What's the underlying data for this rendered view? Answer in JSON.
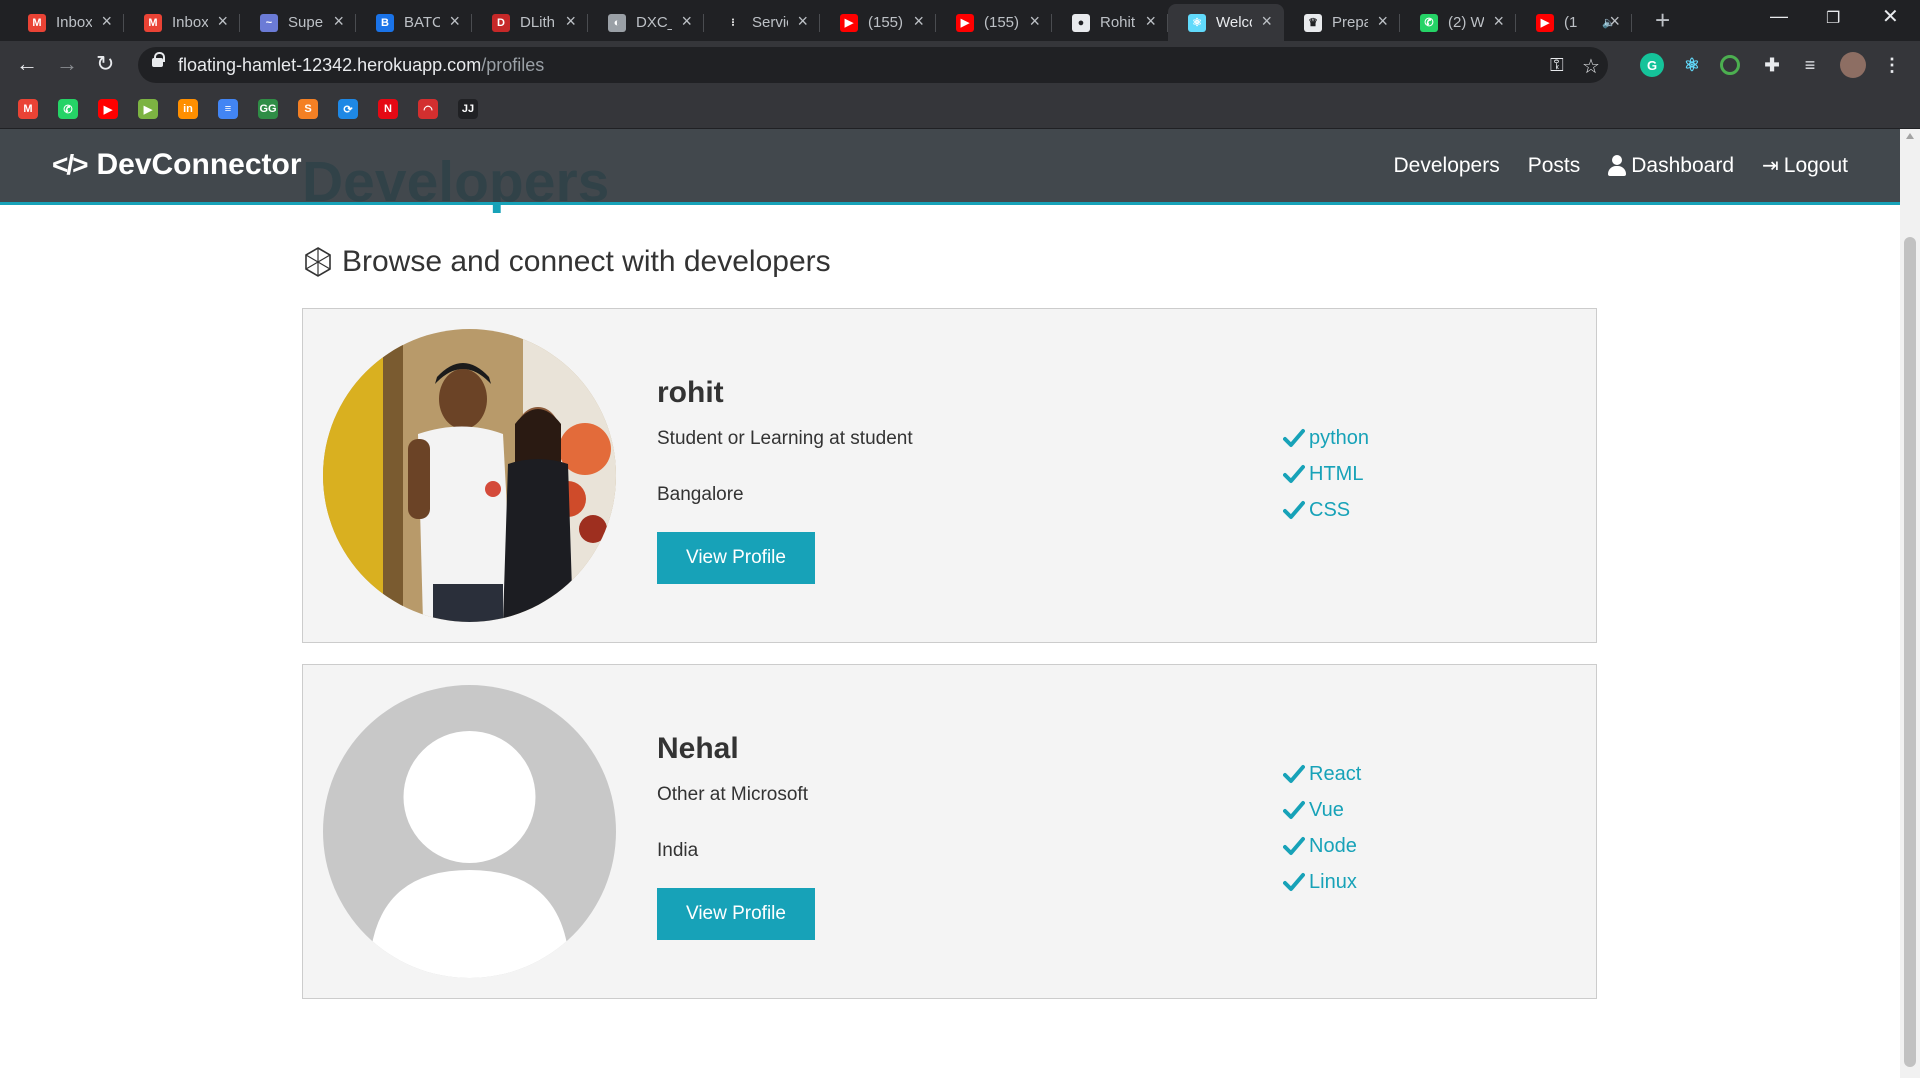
{
  "browser": {
    "tabs": [
      {
        "title": "Inbox",
        "icon": "gmail-icon",
        "color": "#ea4335",
        "glyph": "M"
      },
      {
        "title": "Inbox",
        "icon": "gmail-icon",
        "color": "#ea4335",
        "glyph": "M"
      },
      {
        "title": "Super",
        "icon": "swirl-icon",
        "color": "#6b7bd6",
        "glyph": "~"
      },
      {
        "title": "BATCI",
        "icon": "user-card-icon",
        "color": "#1a73e8",
        "glyph": "B"
      },
      {
        "title": "DLith",
        "icon": "book-icon",
        "color": "#c62828",
        "glyph": "D"
      },
      {
        "title": "DXC_",
        "icon": "globe-icon",
        "color": "#9aa0a6",
        "glyph": "◐"
      },
      {
        "title": "Servic",
        "icon": "dots-icon",
        "color": "#202124",
        "glyph": "⁝"
      },
      {
        "title": "(155)",
        "icon": "youtube-icon",
        "color": "#ff0000",
        "glyph": "▶"
      },
      {
        "title": "(155)",
        "icon": "youtube-icon",
        "color": "#ff0000",
        "glyph": "▶"
      },
      {
        "title": "Rohit",
        "icon": "github-icon",
        "color": "#e8eaed",
        "glyph": "●"
      },
      {
        "title": "Welco",
        "icon": "react-icon",
        "color": "#61dafb",
        "glyph": "⚛",
        "active": true
      },
      {
        "title": "Prepa",
        "icon": "trophy-icon",
        "color": "#e8eaed",
        "glyph": "♛"
      },
      {
        "title": "(2) W",
        "icon": "whatsapp-icon",
        "color": "#25d366",
        "glyph": "✆"
      },
      {
        "title": "(1",
        "icon": "youtube-icon",
        "color": "#ff0000",
        "glyph": "▶",
        "audio": true
      }
    ],
    "url_host": "floating-hamlet-12342.herokuapp.com",
    "url_path": "/profiles",
    "bookmarks": [
      {
        "icon": "gmail-icon",
        "color": "#ea4335",
        "glyph": "M"
      },
      {
        "icon": "whatsapp-icon",
        "color": "#25d366",
        "glyph": "✆"
      },
      {
        "icon": "youtube-icon",
        "color": "#ff0000",
        "glyph": "▶"
      },
      {
        "icon": "play-icon",
        "color": "#7cb342",
        "glyph": "▶"
      },
      {
        "icon": "invision-icon",
        "color": "#ff8f00",
        "glyph": "in"
      },
      {
        "icon": "docs-icon",
        "color": "#4285f4",
        "glyph": "≡"
      },
      {
        "icon": "gfg-icon",
        "color": "#2f8d46",
        "glyph": "GG"
      },
      {
        "icon": "stackoverflow-icon",
        "color": "#f48024",
        "glyph": "S"
      },
      {
        "icon": "loop-icon",
        "color": "#1e88e5",
        "glyph": "⟳"
      },
      {
        "icon": "netflix-icon",
        "color": "#e50914",
        "glyph": "N"
      },
      {
        "icon": "speedometer-icon",
        "color": "#d32f2f",
        "glyph": "◠"
      },
      {
        "icon": "jj-icon",
        "color": "#202124",
        "glyph": "JJ"
      }
    ]
  },
  "app": {
    "brand": "DevConnector",
    "nav": {
      "developers": "Developers",
      "posts": "Posts",
      "dashboard": "Dashboard",
      "logout": "Logout"
    },
    "heading": "Developers",
    "lead": "Browse and connect with developers",
    "accent_color": "#17a2b8"
  },
  "profiles": [
    {
      "name": "rohit",
      "status": "Student or Learning at student",
      "location": "Bangalore",
      "button": "View Profile",
      "skills": [
        "python",
        "HTML",
        "CSS"
      ],
      "avatar": "photo"
    },
    {
      "name": "Nehal",
      "status": "Other at Microsoft",
      "location": "India",
      "button": "View Profile",
      "skills": [
        "React",
        "Vue",
        "Node",
        "Linux"
      ],
      "avatar": "default"
    }
  ]
}
